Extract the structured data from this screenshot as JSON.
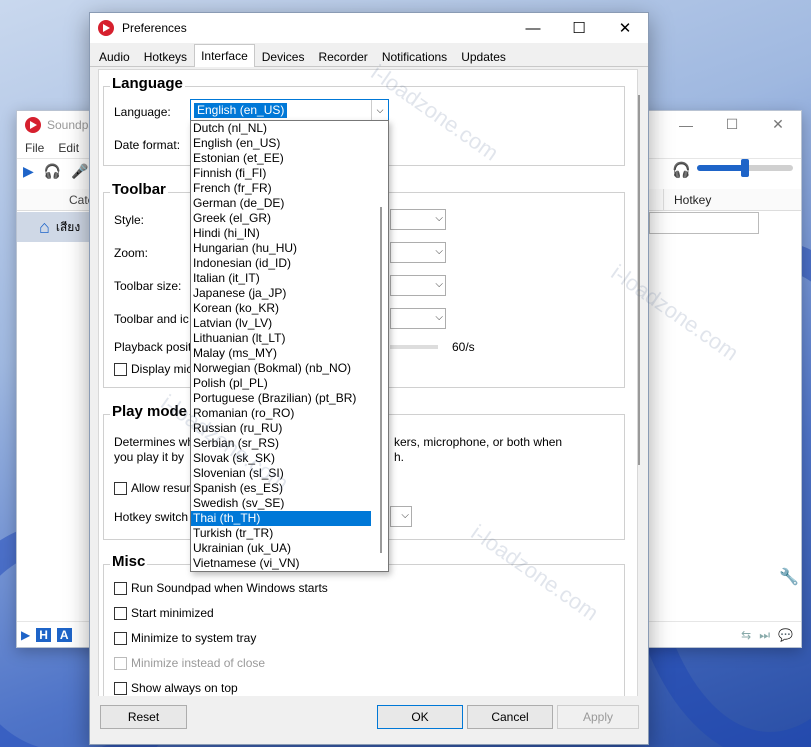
{
  "watermark": "i-loadzone.com",
  "background_window": {
    "title": "Soundpad",
    "menu": [
      "File",
      "Edit"
    ],
    "col_category": "Cate",
    "col_hotkey": "Hotkey",
    "category_item": "เสียง",
    "window_buttons": {
      "minimize": "—",
      "maximize": "☐",
      "close": "✕"
    }
  },
  "dialog": {
    "title": "Preferences",
    "window_buttons": {
      "minimize": "—",
      "maximize": "☐",
      "close": "✕"
    },
    "tabs": [
      "Audio",
      "Hotkeys",
      "Interface",
      "Devices",
      "Recorder",
      "Notifications",
      "Updates"
    ],
    "active_tab": "Interface"
  },
  "language_group": {
    "title": "Language",
    "language_label": "Language:",
    "language_value": "English (en_US)",
    "date_format_label": "Date format:"
  },
  "toolbar_group": {
    "title": "Toolbar",
    "style_label": "Style:",
    "zoom_label": "Zoom:",
    "toolbar_size_label": "Toolbar size:",
    "toolbar_icons_label": "Toolbar and ic",
    "playback_label": "Playback posit",
    "playback_value": "60/s",
    "display_checkbox": "Display mic"
  },
  "play_mode_group": {
    "title": "Play mode",
    "desc_line1_left": "Determines wh",
    "desc_line1_right": "kers, microphone, or both when",
    "desc_line2_left": "you play it by",
    "desc_line2_right": "h.",
    "allow_checkbox": "Allow resum",
    "hotkey_label": "Hotkey switch"
  },
  "misc_group": {
    "title": "Misc",
    "items": [
      {
        "label": "Run Soundpad when Windows starts",
        "disabled": false
      },
      {
        "label": "Start minimized",
        "disabled": false
      },
      {
        "label": "Minimize to system tray",
        "disabled": false
      },
      {
        "label": "Minimize instead of close",
        "disabled": true
      },
      {
        "label": "Show always on top",
        "disabled": false
      }
    ]
  },
  "languages": [
    "Dutch (nl_NL)",
    "English (en_US)",
    "Estonian (et_EE)",
    "Finnish (fi_FI)",
    "French (fr_FR)",
    "German (de_DE)",
    "Greek (el_GR)",
    "Hindi (hi_IN)",
    "Hungarian (hu_HU)",
    "Indonesian (id_ID)",
    "Italian (it_IT)",
    "Japanese (ja_JP)",
    "Korean (ko_KR)",
    "Latvian (lv_LV)",
    "Lithuanian (lt_LT)",
    "Malay (ms_MY)",
    "Norwegian (Bokmal) (nb_NO)",
    "Polish (pl_PL)",
    "Portuguese (Brazilian) (pt_BR)",
    "Romanian (ro_RO)",
    "Russian (ru_RU)",
    "Serbian (sr_RS)",
    "Slovak (sk_SK)",
    "Slovenian (sl_SI)",
    "Spanish (es_ES)",
    "Swedish (sv_SE)",
    "Thai (th_TH)",
    "Turkish (tr_TR)",
    "Ukrainian (uk_UA)",
    "Vietnamese (vi_VN)"
  ],
  "highlighted_language": "Thai (th_TH)",
  "buttons": {
    "reset": "Reset",
    "ok": "OK",
    "cancel": "Cancel",
    "apply": "Apply"
  },
  "colors": {
    "accent": "#0078d7",
    "brand": "#d6202e"
  }
}
